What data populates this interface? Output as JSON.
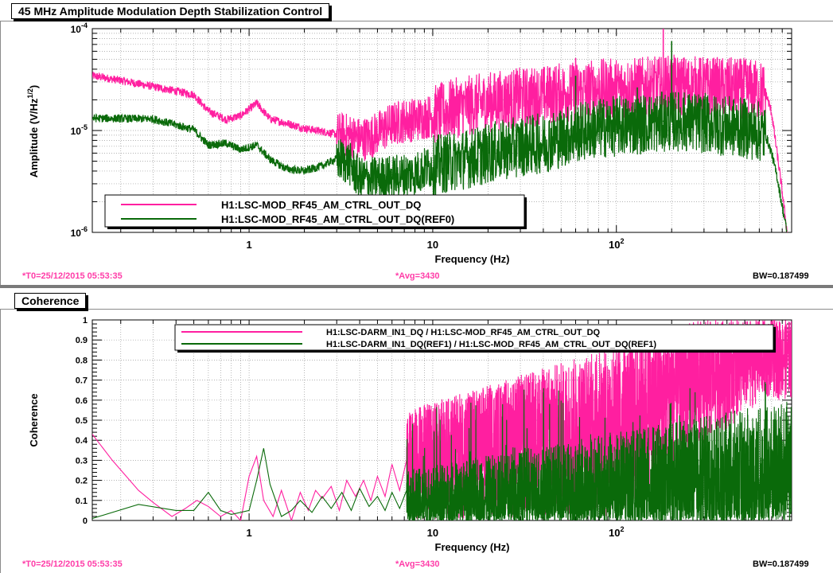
{
  "colors": {
    "series_pink": "#ff1fa0",
    "series_green": "#0a6a0a",
    "footer_pink": "#ff3da8"
  },
  "top": {
    "title": "45 MHz Amplitude Modulation Depth Stabilization Control",
    "footer_t0": "*T0=25/12/2015 05:53:35",
    "footer_avg": "*Avg=3430",
    "footer_bw": "BW=0.187499"
  },
  "bottom": {
    "title": "Coherence",
    "footer_t0": "*T0=25/12/2015 05:53:35",
    "footer_avg": "*Avg=3430",
    "footer_bw": "BW=0.187499"
  },
  "chart_data": [
    {
      "type": "line",
      "xscale": "log",
      "yscale": "log",
      "xlabel": "Frequency (Hz)",
      "ylabel_main": "Amplitude (V/Hz",
      "ylabel_sup": "1/2",
      "ylabel_close": ")",
      "xlim": [
        0.14,
        900
      ],
      "ylim": [
        1e-06,
        0.0001
      ],
      "x_tick_labels": [
        {
          "v": 1,
          "t": "1"
        },
        {
          "v": 10,
          "t": "10"
        },
        {
          "v": 100,
          "t": "10"
        }
      ],
      "x_tick_sup": [
        "",
        "",
        "2"
      ],
      "y_tick_labels": [
        {
          "v": 1e-06,
          "t": "10",
          "s": "-6"
        },
        {
          "v": 1e-05,
          "t": "10",
          "s": "-5"
        },
        {
          "v": 0.0001,
          "t": "10",
          "s": "-4"
        }
      ],
      "grid": true,
      "legend_position": "bottom-left",
      "series": [
        {
          "name": "H1:LSC-MOD_RF45_AM_CTRL_OUT_DQ",
          "color": "#ff1fa0",
          "x": [
            0.14,
            0.2,
            0.3,
            0.5,
            0.6,
            0.75,
            0.9,
            1.1,
            1.3,
            1.6,
            2,
            2.5,
            3,
            3.5,
            4,
            4.5,
            5,
            6,
            7,
            8,
            10,
            13,
            17,
            22,
            30,
            40,
            50,
            60,
            70,
            80,
            100,
            130,
            170,
            200,
            300,
            400,
            500,
            600,
            650,
            700,
            750,
            800,
            850
          ],
          "y": [
            3.45e-05,
            3.1e-05,
            2.7e-05,
            2.25e-05,
            1.55e-05,
            1.28e-05,
            1.4e-05,
            1.85e-05,
            1.3e-05,
            1.18e-05,
            1.05e-05,
            9.8e-06,
            9.2e-06,
            9e-06,
            8.2e-06,
            8.5e-06,
            9.5e-06,
            1.15e-05,
            1.25e-05,
            1.28e-05,
            1.4e-05,
            1.65e-05,
            1.8e-05,
            1.95e-05,
            2.1e-05,
            2.2e-05,
            2.35e-05,
            2.4e-05,
            2.5e-05,
            2.55e-05,
            2.6e-05,
            2.65e-05,
            2.7e-05,
            2.8e-05,
            2.7e-05,
            2.65e-05,
            2.6e-05,
            2.5e-05,
            2.35e-05,
            1.5e-05,
            6e-06,
            2.5e-06,
            1e-06
          ],
          "peaks": [
            {
              "x": 60,
              "y": 5.15e-05
            },
            {
              "x": 180,
              "y": 0.000103
            },
            {
              "x": 130,
              "y": 3.75e-05
            },
            {
              "x": 530,
              "y": 4.05e-05
            }
          ]
        },
        {
          "name": "H1:LSC-MOD_RF45_AM_CTRL_OUT_DQ(REF0)",
          "color": "#0a6a0a",
          "x": [
            0.14,
            0.3,
            0.5,
            0.6,
            0.75,
            0.9,
            1.1,
            1.3,
            1.6,
            2,
            2.5,
            3,
            3.5,
            4,
            5,
            6,
            8,
            10,
            13,
            17,
            22,
            30,
            40,
            50,
            60,
            80,
            100,
            130,
            170,
            200,
            300,
            400,
            500,
            600,
            650,
            700,
            750,
            800,
            850
          ],
          "y": [
            1.32e-05,
            1.3e-05,
            1.02e-05,
            7.2e-06,
            7.5e-06,
            6.5e-06,
            7.2e-06,
            5.2e-06,
            4.2e-06,
            4e-06,
            4.5e-06,
            5.3e-06,
            4.8e-06,
            3.3e-06,
            3.4e-06,
            3.5e-06,
            3.8e-06,
            4.5e-06,
            5e-06,
            5.5e-06,
            6.2e-06,
            7e-06,
            7.5e-06,
            8.5e-06,
            9.5e-06,
            1.05e-05,
            1.1e-05,
            1.15e-05,
            1.2e-05,
            1.25e-05,
            1.18e-05,
            1.1e-05,
            1.05e-05,
            9.8e-06,
            9e-06,
            6e-06,
            3.5e-06,
            1.8e-06,
            1e-06
          ],
          "peaks": [
            {
              "x": 60,
              "y": 3.45e-05
            },
            {
              "x": 180,
              "y": 1.25e-05
            },
            {
              "x": 200,
              "y": 7.55e-05
            },
            {
              "x": 130,
              "y": 2.65e-05
            }
          ]
        }
      ]
    },
    {
      "type": "line",
      "xscale": "log",
      "yscale": "linear",
      "xlabel": "Frequency (Hz)",
      "ylabel": "Coherence",
      "xlim": [
        0.14,
        900
      ],
      "ylim": [
        0,
        1
      ],
      "x_tick_labels": [
        {
          "v": 1,
          "t": "1"
        },
        {
          "v": 10,
          "t": "10"
        },
        {
          "v": 100,
          "t": "10"
        }
      ],
      "x_tick_sup": [
        "",
        "",
        "2"
      ],
      "y_tick_labels": [
        "0",
        "0.1",
        "0.2",
        "0.3",
        "0.4",
        "0.5",
        "0.6",
        "0.7",
        "0.8",
        "0.9",
        "1"
      ],
      "grid": true,
      "legend_position": "top-right",
      "series": [
        {
          "name": "H1:LSC-DARM_IN1_DQ / H1:LSC-MOD_RF45_AM_CTRL_OUT_DQ",
          "color": "#ff1fa0",
          "x": [
            0.14,
            0.18,
            0.25,
            0.3,
            0.38,
            0.45,
            0.52,
            0.6,
            0.7,
            0.8,
            0.9,
            1,
            1.1,
            1.2,
            1.35,
            1.5,
            1.7,
            1.9,
            2.1,
            2.3,
            2.5,
            2.8,
            3.1,
            3.4,
            3.8,
            4.2,
            4.6,
            5,
            5.5,
            6,
            6.6,
            7.2
          ],
          "y": [
            0.43,
            0.3,
            0.15,
            0.09,
            0.02,
            0.06,
            0.1,
            0.07,
            0.02,
            0.05,
            0.0,
            0.22,
            0.32,
            0.1,
            0.02,
            0.15,
            0.0,
            0.14,
            0.05,
            0.15,
            0.11,
            0.17,
            0.05,
            0.2,
            0.12,
            0.2,
            0.1,
            0.22,
            0.12,
            0.28,
            0.15,
            0.3
          ],
          "band_upper": 0.88,
          "band_lower": 0.05
        },
        {
          "name": "H1:LSC-DARM_IN1_DQ(REF1) / H1:LSC-MOD_RF45_AM_CTRL_OUT_DQ(REF1)",
          "color": "#0a6a0a",
          "x": [
            0.14,
            0.25,
            0.4,
            0.5,
            0.6,
            0.7,
            0.8,
            1,
            1.1,
            1.2,
            1.3,
            1.5,
            1.7,
            1.9,
            2.2,
            2.5,
            2.8,
            3.2,
            3.6,
            4,
            4.5,
            5,
            5.5,
            6,
            6.6,
            7.2
          ],
          "y": [
            0.01,
            0.08,
            0.05,
            0.05,
            0.14,
            0.05,
            0.03,
            0.05,
            0.2,
            0.36,
            0.18,
            0.02,
            0.05,
            0.1,
            0.04,
            0.12,
            0.06,
            0.14,
            0.05,
            0.16,
            0.07,
            0.12,
            0.05,
            0.14,
            0.06,
            0.15
          ],
          "band_upper": 0.45,
          "band_lower": 0.0
        }
      ]
    }
  ]
}
